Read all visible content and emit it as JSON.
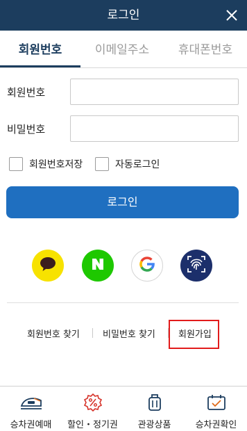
{
  "header": {
    "title": "로그인",
    "close_icon": "close-icon"
  },
  "tabs": [
    {
      "label": "회원번호",
      "active": true
    },
    {
      "label": "이메일주소",
      "active": false
    },
    {
      "label": "휴대폰번호",
      "active": false
    }
  ],
  "form": {
    "member_number_label": "회원번호",
    "member_number_value": "",
    "password_label": "비밀번호",
    "password_value": "",
    "save_member_number_label": "회원번호저장",
    "auto_login_label": "자동로그인",
    "login_button_label": "로그인"
  },
  "social_login": {
    "kakao_icon": "kakao-speech-bubble-icon",
    "naver_icon": "naver-n-icon",
    "google_icon": "google-g-icon",
    "biometric_icon": "fingerprint-icon"
  },
  "links": {
    "find_member_number": "회원번호 찾기",
    "find_password": "비밀번호 찾기",
    "sign_up": "회원가입"
  },
  "bottom_nav": [
    {
      "label": "승차권예매",
      "icon": "ktx-train-icon"
    },
    {
      "label": "할인・정기권",
      "icon": "discount-gear-icon"
    },
    {
      "label": "관광상품",
      "icon": "luggage-icon"
    },
    {
      "label": "승차권확인",
      "icon": "ticket-check-icon"
    }
  ],
  "colors": {
    "header_bg": "#1c3d5e",
    "primary_button": "#1f6fc0",
    "kakao": "#f7e200",
    "naver": "#1ec800",
    "highlight_border": "#e21b1b"
  }
}
